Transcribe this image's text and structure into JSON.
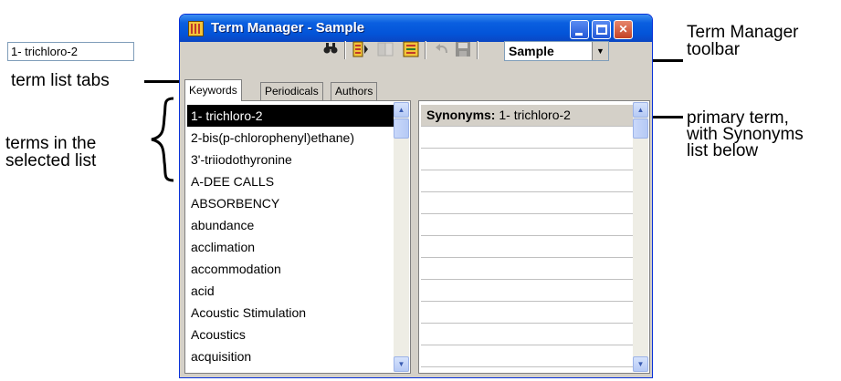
{
  "window": {
    "title": "Term Manager - Sample",
    "controls": {
      "minimize": "minimize",
      "maximize": "maximize",
      "close": "✕"
    }
  },
  "toolbar": {
    "search_value": "1- trichloro-2",
    "database_selected": "Sample",
    "icons": [
      "find-icon",
      "sort-icon",
      "merge-icon",
      "numbered-list-icon",
      "undo-icon",
      "save-icon"
    ]
  },
  "tabs": [
    {
      "label": "Keywords",
      "active": true
    },
    {
      "label": "Periodicals",
      "active": false
    },
    {
      "label": "Authors",
      "active": false
    }
  ],
  "term_list": {
    "items": [
      "1- trichloro-2",
      "2-bis(p-chlorophenyl)ethane)",
      "3'-triiodothyronine",
      "A-DEE CALLS",
      "ABSORBENCY",
      "abundance",
      "acclimation",
      "accommodation",
      "acid",
      "Acoustic Stimulation",
      "Acoustics",
      "acquisition"
    ],
    "selected_index": 0
  },
  "synonyms": {
    "header_label": "Synonyms:",
    "primary_term": "1- trichloro-2",
    "empty_rows": 11
  },
  "annotations": {
    "toolbar_line1": "Term Manager",
    "toolbar_line2": "toolbar",
    "tabs": "term list tabs",
    "terms_line1": "terms in the",
    "terms_line2": "selected list",
    "primary_line1": "primary term,",
    "primary_line2": "with Synonyms",
    "primary_line3": "list below"
  },
  "colors": {
    "title_bar": "#0a5fe0",
    "selection": "#000000",
    "window_face": "#d4d0c8"
  }
}
